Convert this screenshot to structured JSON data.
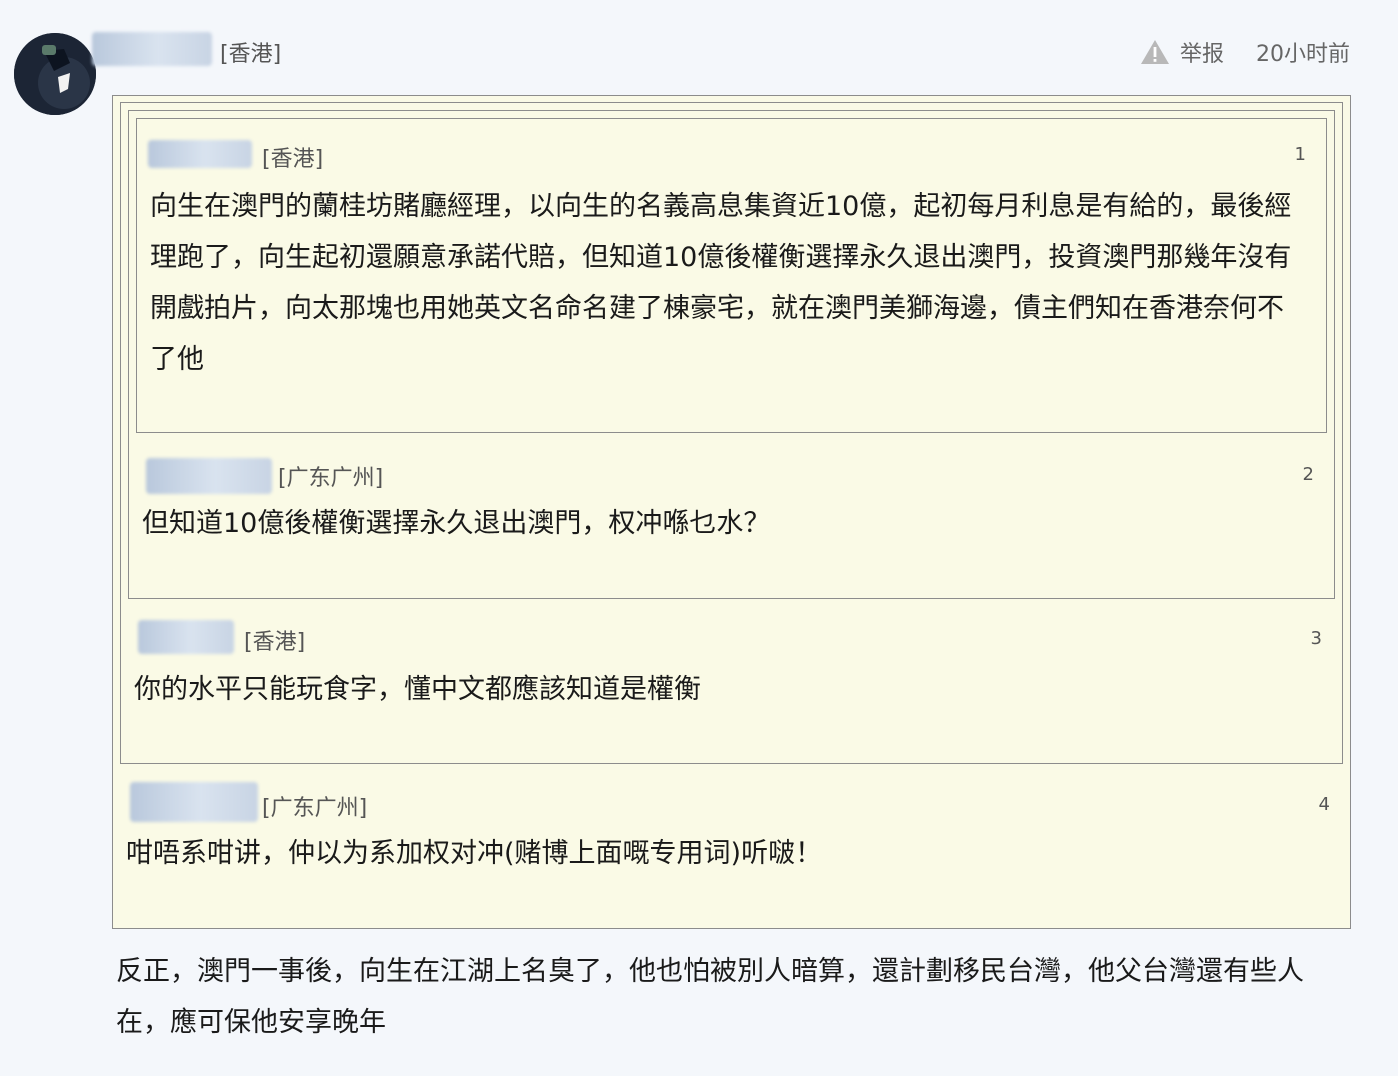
{
  "post": {
    "location": "[香港]",
    "report_label": "举报",
    "time_ago": "20小时前",
    "reply_text": "反正，澳門一事後，向生在江湖上名臭了，他也怕被別人暗算，還計劃移民台灣，他父台灣還有些人在，應可保他安享晚年"
  },
  "quotes": [
    {
      "floor": "4",
      "location": "[广东广州]",
      "text": "咁唔系咁讲，仲以为系加权对冲(赌博上面嘅专用词)听啵！"
    },
    {
      "floor": "3",
      "location": "[香港]",
      "text": "你的水平只能玩食字，懂中文都應該知道是權衡"
    },
    {
      "floor": "2",
      "location": "[广东广州]",
      "text": "但知道10億後權衡選擇永久退出澳門，权冲喺乜水？"
    },
    {
      "floor": "1",
      "location": "[香港]",
      "text": "向生在澳門的蘭桂坊賭廳經理，以向生的名義高息集資近10億，起初每月利息是有給的，最後經理跑了，向生起初還願意承諾代賠，但知道10億後權衡選擇永久退出澳門，投資澳門那幾年沒有開戲拍片，向太那塊也用她英文名命名建了棟豪宅，就在澳門美獅海邊，債主們知在香港奈何不了他"
    }
  ],
  "colors": {
    "quote_bg": "#fafae6",
    "quote_border": "#8c8c8c",
    "page_bg": "#f4f7fb"
  },
  "icons": {
    "report": "warning-triangle-icon"
  }
}
